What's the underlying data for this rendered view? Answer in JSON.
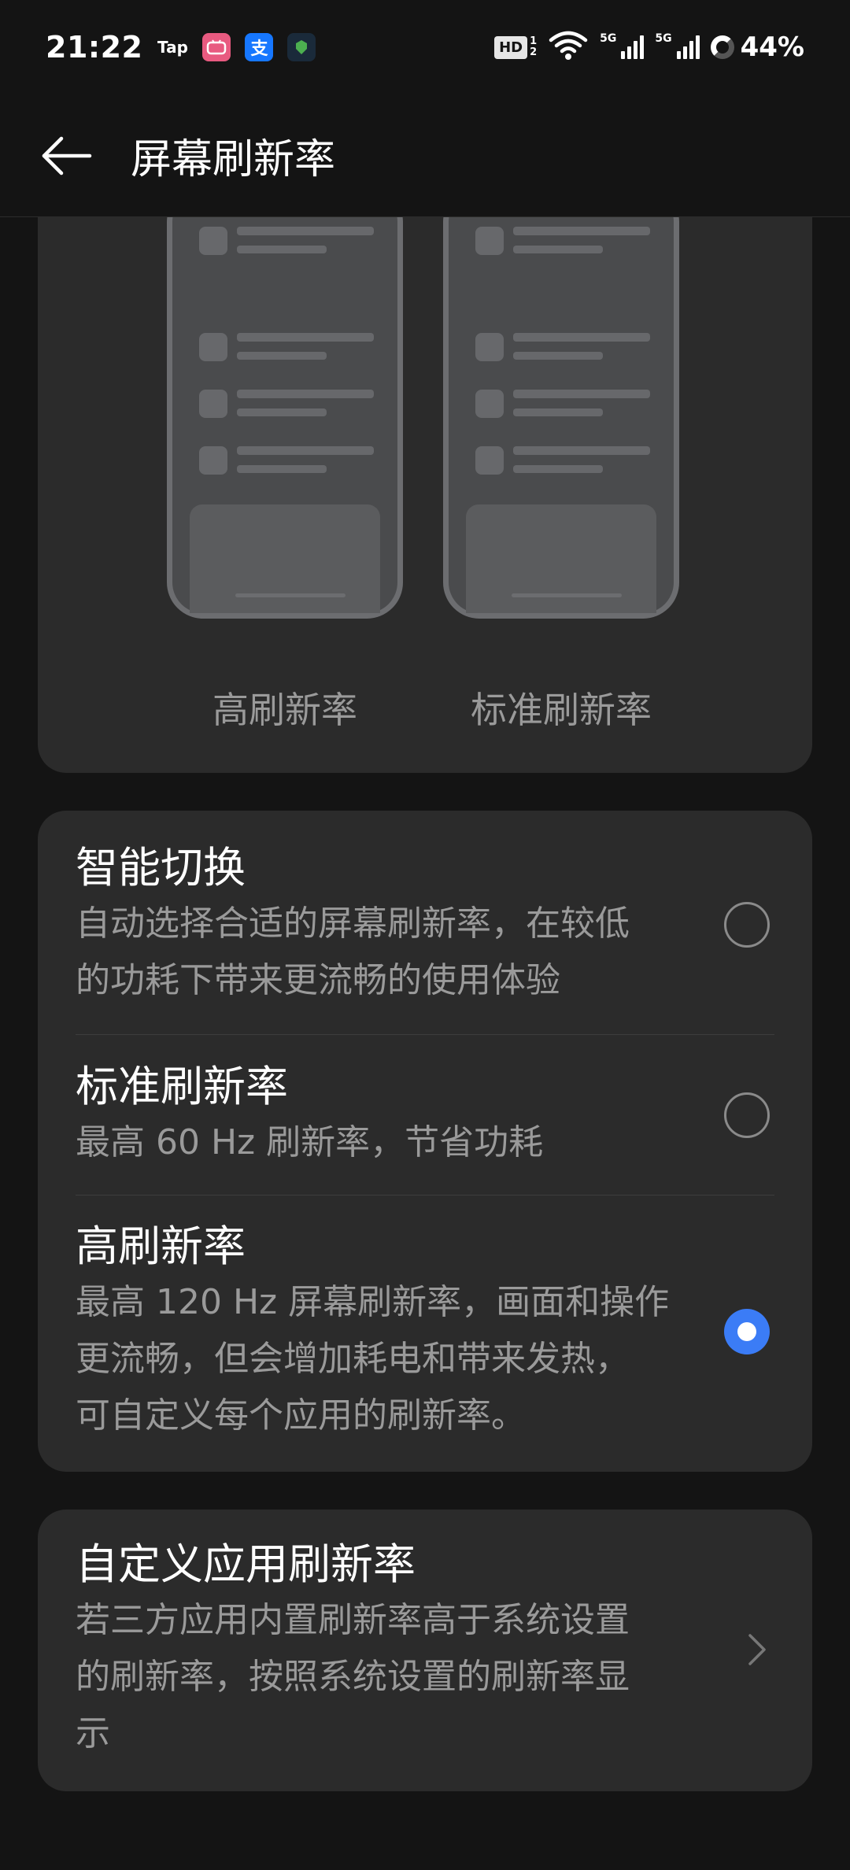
{
  "status_bar": {
    "time": "21:22",
    "apps": [
      "Tap",
      "bilibili",
      "支",
      "shield"
    ],
    "hd_label": "HD",
    "hd_sub_top": "1",
    "hd_sub_bottom": "2",
    "sig1_label": "5G",
    "sig2_label": "5G",
    "battery": "44%"
  },
  "header": {
    "title": "屏幕刷新率",
    "back_icon": "arrow-left-icon"
  },
  "preview": {
    "left_label": "高刷新率",
    "right_label": "标准刷新率"
  },
  "options": [
    {
      "title": "智能切换",
      "desc_lines": [
        "自动选择合适的屏幕刷新率，在较低",
        "的功耗下带来更流畅的使用体验"
      ],
      "selected": false
    },
    {
      "title": "标准刷新率",
      "desc_lines": [
        "最高 60 Hz 刷新率，节省功耗"
      ],
      "selected": false
    },
    {
      "title": "高刷新率",
      "desc_lines": [
        "最高 120 Hz 屏幕刷新率，画面和操作",
        "更流畅，但会增加耗电和带来发热，",
        "可自定义每个应用的刷新率。"
      ],
      "selected": true
    }
  ],
  "custom": {
    "title": "自定义应用刷新率",
    "desc_lines": [
      "若三方应用内置刷新率高于系统设置",
      "的刷新率，按照系统设置的刷新率显",
      "示"
    ],
    "chevron_icon": "chevron-right-icon"
  },
  "colors": {
    "background": "#141414",
    "card": "#2b2b2b",
    "accent": "#3b7cf6",
    "secondary_text": "#9a9a9a"
  }
}
